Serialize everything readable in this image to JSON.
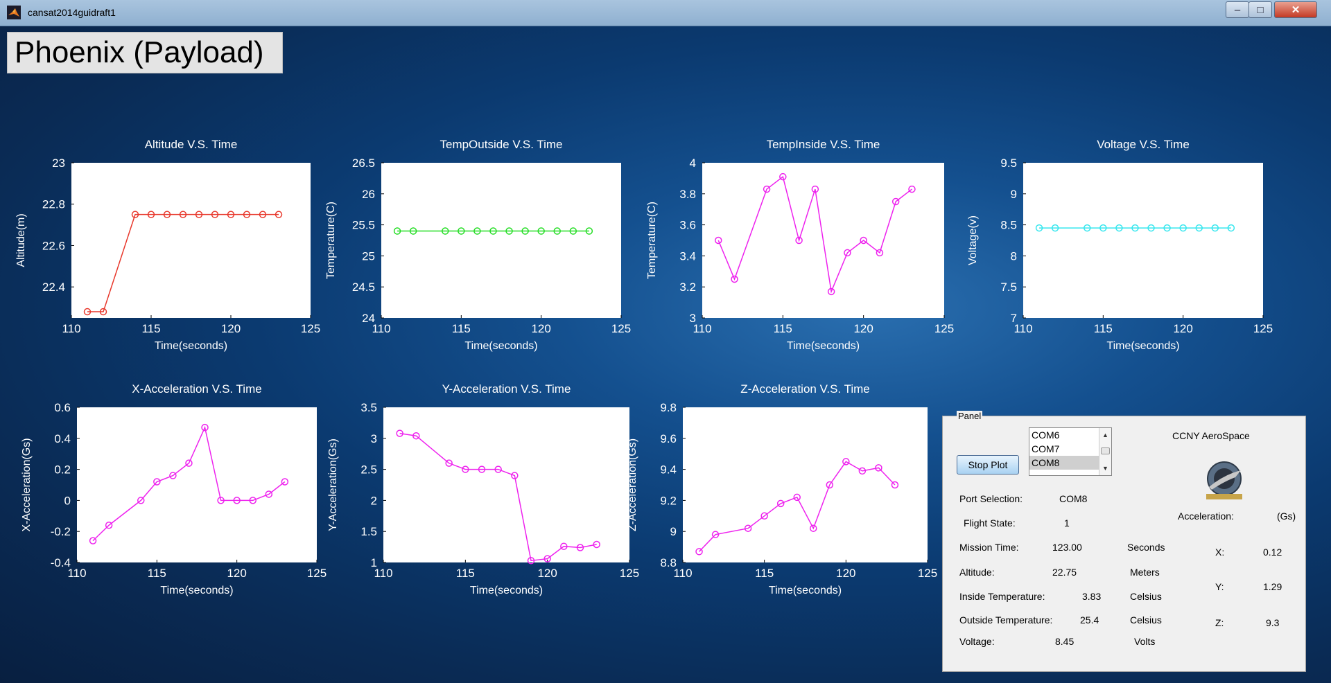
{
  "window": {
    "title": "cansat2014guidraft1",
    "minimize": "–",
    "maximize": "□",
    "close": "✕"
  },
  "header": {
    "title": "Phoenix (Payload)"
  },
  "colors": {
    "red": "#e8372b",
    "green": "#22dd22",
    "magenta": "#ee22ee",
    "cyan": "#33e6ee"
  },
  "chart_data": [
    {
      "type": "line",
      "title": "Altitude V.S. Time",
      "xlabel": "Time(seconds)",
      "ylabel": "Altitude(m)",
      "xlim": [
        110,
        125
      ],
      "ylim": [
        22.25,
        23
      ],
      "xticks": [
        110,
        115,
        120,
        125
      ],
      "yticks": [
        22.4,
        22.6,
        22.8,
        23
      ],
      "yticklabels": [
        "22.4",
        "22.6",
        "22.8",
        "23"
      ],
      "color": "#e8372b",
      "x": [
        111,
        112,
        114,
        115,
        116,
        117,
        118,
        119,
        120,
        121,
        122,
        123
      ],
      "y": [
        22.28,
        22.28,
        22.75,
        22.75,
        22.75,
        22.75,
        22.75,
        22.75,
        22.75,
        22.75,
        22.75,
        22.75
      ]
    },
    {
      "type": "line",
      "title": "TempOutside V.S. Time",
      "xlabel": "Time(seconds)",
      "ylabel": "Temperature(C)",
      "xlim": [
        110,
        125
      ],
      "ylim": [
        24,
        26.5
      ],
      "xticks": [
        110,
        115,
        120,
        125
      ],
      "yticks": [
        24,
        24.5,
        25,
        25.5,
        26,
        26.5
      ],
      "yticklabels": [
        "24",
        "24.5",
        "25",
        "25.5",
        "26",
        "26.5"
      ],
      "color": "#22dd22",
      "x": [
        111,
        112,
        114,
        115,
        116,
        117,
        118,
        119,
        120,
        121,
        122,
        123
      ],
      "y": [
        25.4,
        25.4,
        25.4,
        25.4,
        25.4,
        25.4,
        25.4,
        25.4,
        25.4,
        25.4,
        25.4,
        25.4
      ]
    },
    {
      "type": "line",
      "title": "TempInside V.S. Time",
      "xlabel": "Time(seconds)",
      "ylabel": "Temperature(C)",
      "xlim": [
        110,
        125
      ],
      "ylim": [
        3,
        4
      ],
      "xticks": [
        110,
        115,
        120,
        125
      ],
      "yticks": [
        3,
        3.2,
        3.4,
        3.6,
        3.8,
        4
      ],
      "yticklabels": [
        "3",
        "3.2",
        "3.4",
        "3.6",
        "3.8",
        "4"
      ],
      "color": "#ee22ee",
      "x": [
        111,
        112,
        114,
        115,
        116,
        117,
        118,
        119,
        120,
        121,
        122,
        123
      ],
      "y": [
        3.5,
        3.25,
        3.83,
        3.91,
        3.5,
        3.83,
        3.17,
        3.42,
        3.5,
        3.42,
        3.75,
        3.83
      ]
    },
    {
      "type": "line",
      "title": "Voltage V.S. Time",
      "xlabel": "Time(seconds)",
      "ylabel": "Voltage(v)",
      "xlim": [
        110,
        125
      ],
      "ylim": [
        7,
        9.5
      ],
      "xticks": [
        110,
        115,
        120,
        125
      ],
      "yticks": [
        7,
        7.5,
        8,
        8.5,
        9,
        9.5
      ],
      "yticklabels": [
        "7",
        "7.5",
        "8",
        "8.5",
        "9",
        "9.5"
      ],
      "color": "#33e6ee",
      "x": [
        111,
        112,
        114,
        115,
        116,
        117,
        118,
        119,
        120,
        121,
        122,
        123
      ],
      "y": [
        8.45,
        8.45,
        8.45,
        8.45,
        8.45,
        8.45,
        8.45,
        8.45,
        8.45,
        8.45,
        8.45,
        8.45
      ]
    },
    {
      "type": "line",
      "title": "X-Acceleration V.S. Time",
      "xlabel": "Time(seconds)",
      "ylabel": "X-Acceleration(Gs)",
      "xlim": [
        110,
        125
      ],
      "ylim": [
        -0.4,
        0.6
      ],
      "xticks": [
        110,
        115,
        120,
        125
      ],
      "yticks": [
        -0.4,
        -0.2,
        0,
        0.2,
        0.4,
        0.6
      ],
      "yticklabels": [
        "-0.4",
        "-0.2",
        "0",
        "0.2",
        "0.4",
        "0.6"
      ],
      "color": "#ee22ee",
      "x": [
        111,
        112,
        114,
        115,
        116,
        117,
        118,
        119,
        120,
        121,
        122,
        123
      ],
      "y": [
        -0.26,
        -0.16,
        0,
        0.12,
        0.16,
        0.24,
        0.47,
        0,
        0,
        0,
        0.04,
        0.12
      ]
    },
    {
      "type": "line",
      "title": "Y-Acceleration V.S. Time",
      "xlabel": "Time(seconds)",
      "ylabel": "Y-Acceleration(Gs)",
      "xlim": [
        110,
        125
      ],
      "ylim": [
        1,
        3.5
      ],
      "xticks": [
        110,
        115,
        120,
        125
      ],
      "yticks": [
        1,
        1.5,
        2,
        2.5,
        3,
        3.5
      ],
      "yticklabels": [
        "1",
        "1.5",
        "2",
        "2.5",
        "3",
        "3.5"
      ],
      "color": "#ee22ee",
      "x": [
        111,
        112,
        114,
        115,
        116,
        117,
        118,
        119,
        120,
        121,
        122,
        123
      ],
      "y": [
        3.08,
        3.04,
        2.6,
        2.5,
        2.5,
        2.5,
        2.4,
        1.03,
        1.06,
        1.26,
        1.24,
        1.29
      ]
    },
    {
      "type": "line",
      "title": "Z-Acceleration V.S. Time",
      "xlabel": "Time(seconds)",
      "ylabel": "Z-Acceleration(Gs)",
      "xlim": [
        110,
        125
      ],
      "ylim": [
        8.8,
        9.8
      ],
      "xticks": [
        110,
        115,
        120,
        125
      ],
      "yticks": [
        8.8,
        9,
        9.2,
        9.4,
        9.6,
        9.8
      ],
      "yticklabels": [
        "8.8",
        "9",
        "9.2",
        "9.4",
        "9.6",
        "9.8"
      ],
      "color": "#ee22ee",
      "x": [
        111,
        112,
        114,
        115,
        116,
        117,
        118,
        119,
        120,
        121,
        122,
        123
      ],
      "y": [
        8.87,
        8.98,
        9.02,
        9.1,
        9.18,
        9.22,
        9.02,
        9.3,
        9.45,
        9.39,
        9.41,
        9.3
      ]
    }
  ],
  "panel": {
    "legend": "Panel",
    "stop_button": "Stop Plot",
    "ports": [
      "COM6",
      "COM7",
      "COM8"
    ],
    "selected_port_index": 2,
    "org_name": "CCNY AeroSpace",
    "logo_icon": "ccny-aerospace-logo",
    "port_selection_label": "Port Selection:",
    "port_selection_value": "COM8",
    "flight_state_label": "Flight State:",
    "flight_state_value": "1",
    "mission_time_label": "Mission Time:",
    "mission_time_value": "123.00",
    "mission_time_unit": "Seconds",
    "altitude_label": "Altitude:",
    "altitude_value": "22.75",
    "altitude_unit": "Meters",
    "inside_temp_label": "Inside Temperature:",
    "inside_temp_value": "3.83",
    "inside_temp_unit": "Celsius",
    "outside_temp_label": "Outside Temperature:",
    "outside_temp_value": "25.4",
    "outside_temp_unit": "Celsius",
    "voltage_label": "Voltage:",
    "voltage_value": "8.45",
    "voltage_unit": "Volts",
    "acceleration_label": "Acceleration:",
    "acceleration_unit": "(Gs)",
    "x_label": "X:",
    "x_value": "0.12",
    "y_label": "Y:",
    "y_value": "1.29",
    "z_label": "Z:",
    "z_value": "9.3"
  }
}
